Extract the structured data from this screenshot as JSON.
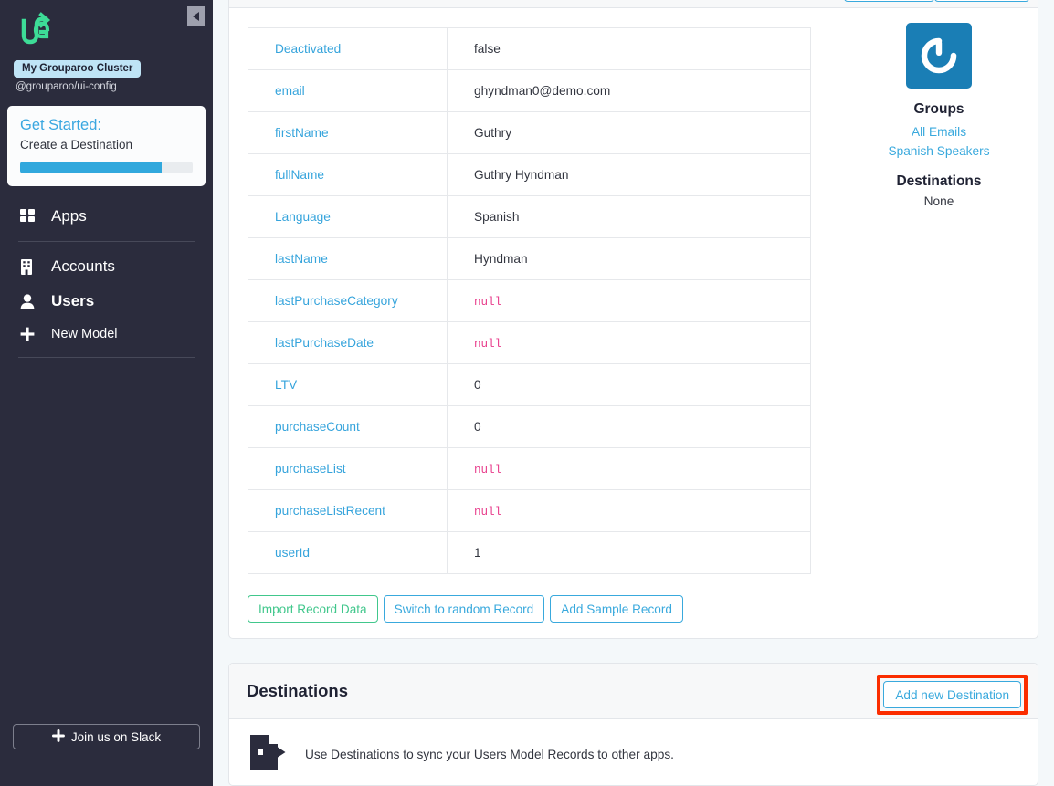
{
  "sidebar": {
    "logo_icon": "grouparoo-logo-icon",
    "collapse_icon": "chevron-left-icon",
    "cluster_badge": "My Grouparoo Cluster",
    "cluster_config": "@grouparoo/ui-config",
    "get_started": {
      "title": "Get Started:",
      "subtitle": "Create a Destination",
      "progress_percent": 82
    },
    "nav": [
      {
        "label": "Apps",
        "icon": "grid-icon",
        "bold": false
      },
      {
        "label": "Accounts",
        "icon": "building-icon",
        "bold": false
      },
      {
        "label": "Users",
        "icon": "user-icon",
        "bold": true
      },
      {
        "label": "New Model",
        "icon": "plus-icon",
        "bold": false
      }
    ],
    "slack": {
      "label": "Join us on Slack",
      "icon": "slack-icon"
    }
  },
  "record_card": {
    "header_buttons": [
      "",
      ""
    ],
    "table": {
      "rows": [
        {
          "key": "Deactivated",
          "value": "false",
          "null": false
        },
        {
          "key": "email",
          "value": "ghyndman0@demo.com",
          "null": false
        },
        {
          "key": "firstName",
          "value": "Guthry",
          "null": false
        },
        {
          "key": "fullName",
          "value": "Guthry Hyndman",
          "null": false
        },
        {
          "key": "Language",
          "value": "Spanish",
          "null": false
        },
        {
          "key": "lastName",
          "value": "Hyndman",
          "null": false
        },
        {
          "key": "lastPurchaseCategory",
          "value": "null",
          "null": true
        },
        {
          "key": "lastPurchaseDate",
          "value": "null",
          "null": true
        },
        {
          "key": "LTV",
          "value": "0",
          "null": false
        },
        {
          "key": "purchaseCount",
          "value": "0",
          "null": false
        },
        {
          "key": "purchaseList",
          "value": "null",
          "null": true
        },
        {
          "key": "purchaseListRecent",
          "value": "null",
          "null": true
        },
        {
          "key": "userId",
          "value": "1",
          "null": false
        }
      ]
    },
    "buttons": {
      "import": "Import Record Data",
      "switch": "Switch to random Record",
      "sample": "Add Sample Record"
    },
    "rail": {
      "avatar_icon": "gravatar-avatar",
      "groups_heading": "Groups",
      "groups": [
        "All Emails",
        "Spanish Speakers"
      ],
      "destinations_heading": "Destinations",
      "destinations_none": "None"
    }
  },
  "destinations_card": {
    "title": "Destinations",
    "add_button": "Add new Destination",
    "icon": "file-export-icon",
    "description": "Use Destinations to sync your Users Model Records to other apps."
  },
  "colors": {
    "sidebar_bg": "#2b2c3d",
    "page_bg": "#f4f8fa",
    "link_blue": "#36a4dc",
    "accent_green": "#41c78c",
    "null_pink": "#e83e8c",
    "highlight_red": "#fb2d00",
    "badge_blue": "#bfe4f6",
    "avatar_blue": "#1a7eb5"
  }
}
